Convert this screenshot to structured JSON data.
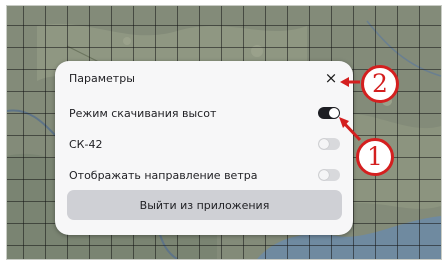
{
  "dialog": {
    "title": "Параметры",
    "close_glyph": "×",
    "options": [
      {
        "label": "Режим скачивания высот",
        "enabled": true
      },
      {
        "label": "СК-42",
        "enabled": false
      },
      {
        "label": "Отображать направление ветра",
        "enabled": false
      }
    ],
    "exit_label": "Выйти из приложения"
  },
  "callouts": [
    {
      "number": "1",
      "target": "elevation-download-toggle"
    },
    {
      "number": "2",
      "target": "close-button"
    }
  ],
  "colors": {
    "callout": "#d41f1f",
    "toggle_on": "#1d1e23",
    "toggle_off": "#d8d9dc",
    "button": "#cfd0d5"
  }
}
